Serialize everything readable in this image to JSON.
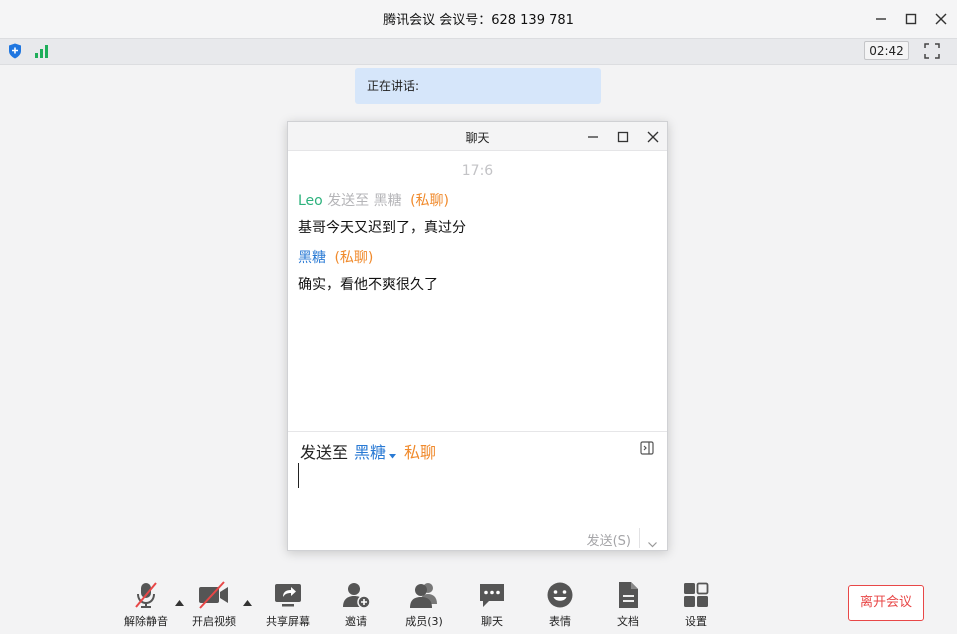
{
  "window": {
    "title": "腾讯会议 会议号：628 139 781"
  },
  "statusbar": {
    "timer": "02:42",
    "shield_icon": "shield-icon",
    "signal_icon": "signal-bars-icon"
  },
  "speaking": {
    "label": "正在讲话:"
  },
  "chat": {
    "title": "聊天",
    "time": "17:6",
    "messages": [
      {
        "sender": "Leo",
        "send_to_label": "发送至",
        "recipient": "黑糖",
        "private_tag": "(私聊)",
        "text": "基哥今天又迟到了，真过分"
      },
      {
        "sender": "黑糖",
        "private_tag": "(私聊)",
        "text": "确实，看他不爽很久了"
      }
    ],
    "composer": {
      "send_to_label": "发送至",
      "recipient": "黑糖",
      "private_label": "私聊",
      "send_button": "发送(S)"
    }
  },
  "toolbar": {
    "unmute": "解除静音",
    "start_video": "开启视频",
    "share_screen": "共享屏幕",
    "invite": "邀请",
    "members": "成员(3)",
    "chat": "聊天",
    "reactions": "表情",
    "documents": "文档",
    "settings": "设置",
    "leave": "离开会议"
  },
  "colors": {
    "accent_blue": "#2a7ad4",
    "green": "#2db27d",
    "orange": "#f08a2c",
    "danger": "#e84747"
  }
}
